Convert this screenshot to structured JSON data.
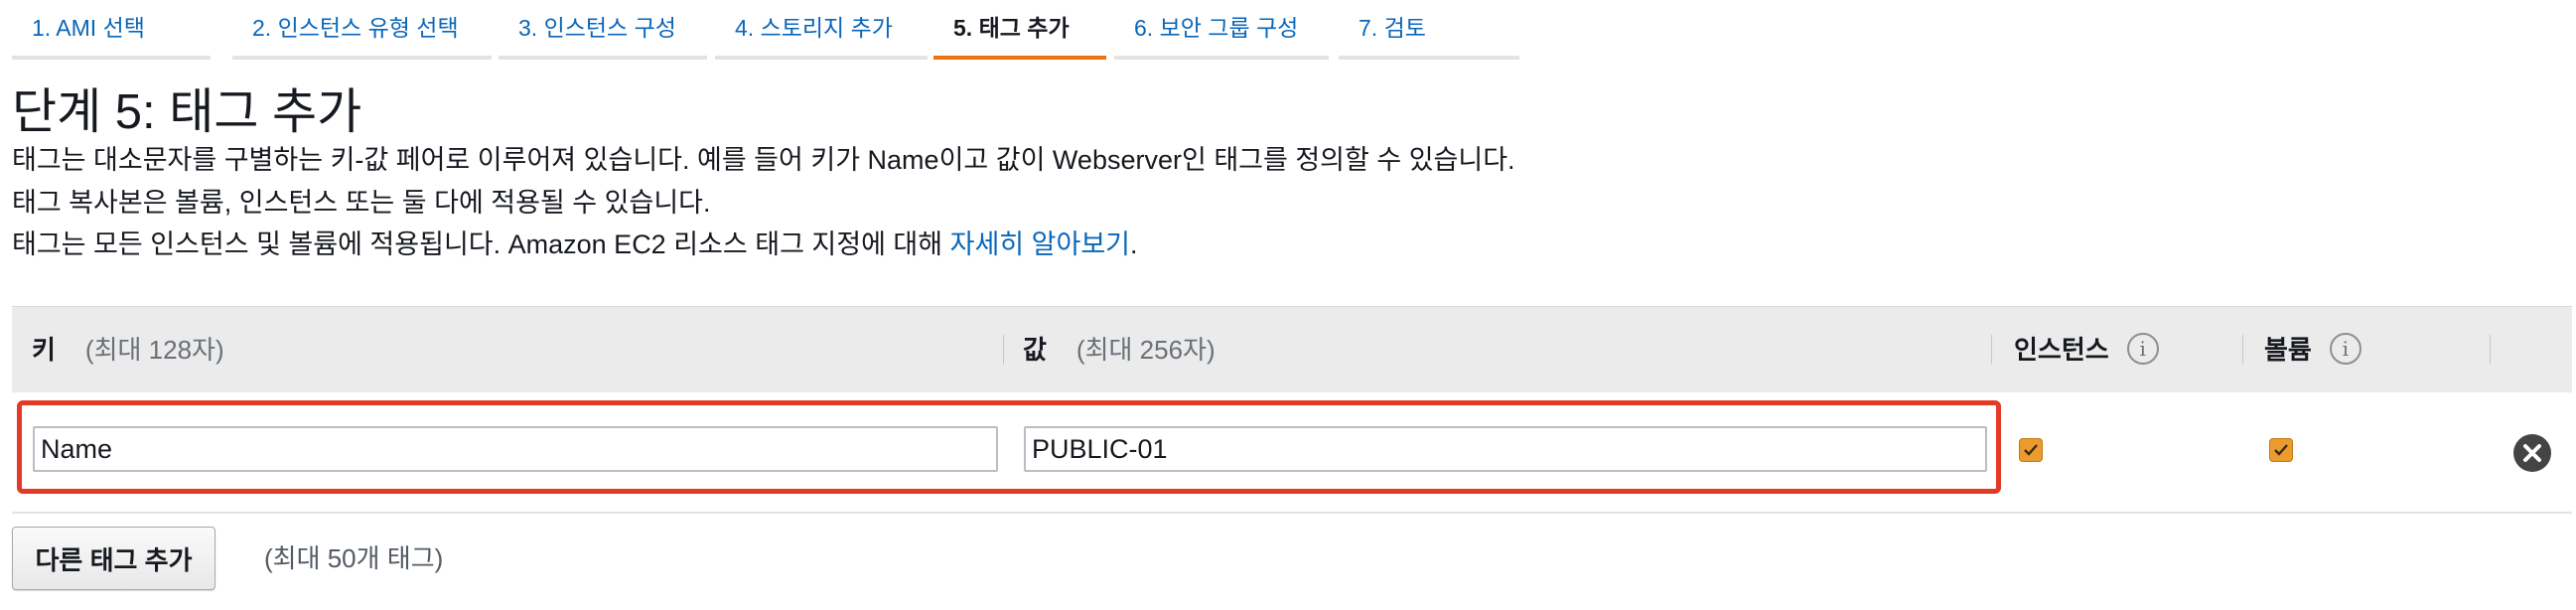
{
  "tabs": [
    {
      "label": "1. AMI 선택"
    },
    {
      "label": "2. 인스턴스 유형 선택"
    },
    {
      "label": "3. 인스턴스 구성"
    },
    {
      "label": "4. 스토리지 추가"
    },
    {
      "label": "5. 태그 추가",
      "active": true
    },
    {
      "label": "6. 보안 그룹 구성"
    },
    {
      "label": "7. 검토"
    }
  ],
  "page": {
    "title": "단계 5: 태그 추가",
    "desc_line1": "태그는 대소문자를 구별하는 키-값 페어로 이루어져 있습니다. 예를 들어 키가 Name이고 값이 Webserver인 태그를 정의할 수 있습니다.",
    "desc_line2": "태그 복사본은 볼륨, 인스턴스 또는 둘 다에 적용될 수 있습니다.",
    "desc_line3": "태그는 모든 인스턴스 및 볼륨에 적용됩니다. Amazon EC2 리소스 태그 지정에 대해",
    "learn_more": "자세히 알아보기",
    "period": "."
  },
  "table": {
    "headers": {
      "key": "키",
      "key_hint": "(최대 128자)",
      "value": "값",
      "value_hint": "(최대 256자)",
      "instances": "인스턴스",
      "volumes": "볼륨",
      "info_icon": "i"
    },
    "rows": [
      {
        "key": "Name",
        "value": "PUBLIC-01",
        "instances_checked": true,
        "volumes_checked": true
      }
    ]
  },
  "actions": {
    "add_tag": "다른 태그 추가",
    "add_tag_hint": "(최대 50개 태그)"
  },
  "colors": {
    "link": "#0a66b8",
    "accent": "#ec7211",
    "highlight": "#e23a25",
    "checkbox": "#ec9b2e"
  }
}
